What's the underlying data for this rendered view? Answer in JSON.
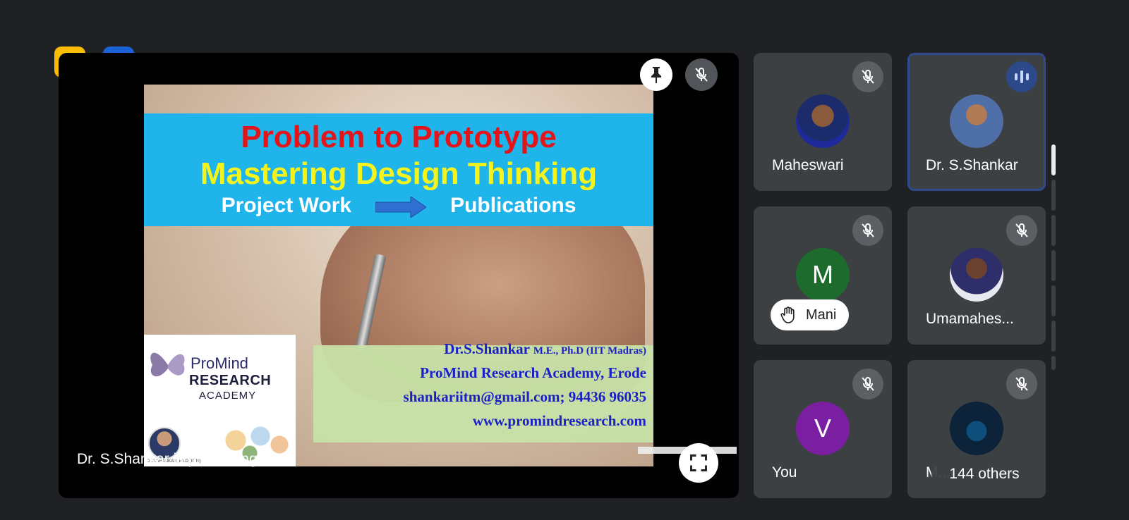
{
  "toolbar": {
    "icon1": "no-caption-icon",
    "icon2": "annotate-pen-icon"
  },
  "stage": {
    "presenting_text": "Dr. S.Shankar is presenting"
  },
  "slide": {
    "title_line1": "Problem to Prototype",
    "title_line2": "Mastering Design Thinking",
    "sub_left": "Project Work",
    "sub_right": "Publications",
    "author": "Dr.S.Shankar",
    "author_degree": "M.E., Ph.D (IIT Madras)",
    "org": "ProMind Research Academy, Erode",
    "contact": "shankariitm@gmail.com; 94436 96035",
    "website": "www.promindresearch.com",
    "logo_line1": "ProMind",
    "logo_line2": "RESEARCH",
    "logo_line3": "ACADEMY",
    "logo_small": "Dr.S.SHANKAR, Ph.D (IITM)"
  },
  "participants": [
    {
      "name": "Maheswari",
      "initial": ""
    },
    {
      "name": "Dr. S.Shankar",
      "initial": ""
    },
    {
      "name": "M",
      "initial": "M",
      "hand_name": "Mani"
    },
    {
      "name": "Umamahes...",
      "initial": ""
    },
    {
      "name": "You",
      "initial": "V"
    },
    {
      "name": "M...",
      "initial": "",
      "others": "144 others"
    }
  ],
  "colors": {
    "background": "#202124",
    "tile": "#3c4043",
    "active_border": "#2f4a8f",
    "caption_button": "#fbbc04",
    "pen_button": "#1a63d6"
  }
}
